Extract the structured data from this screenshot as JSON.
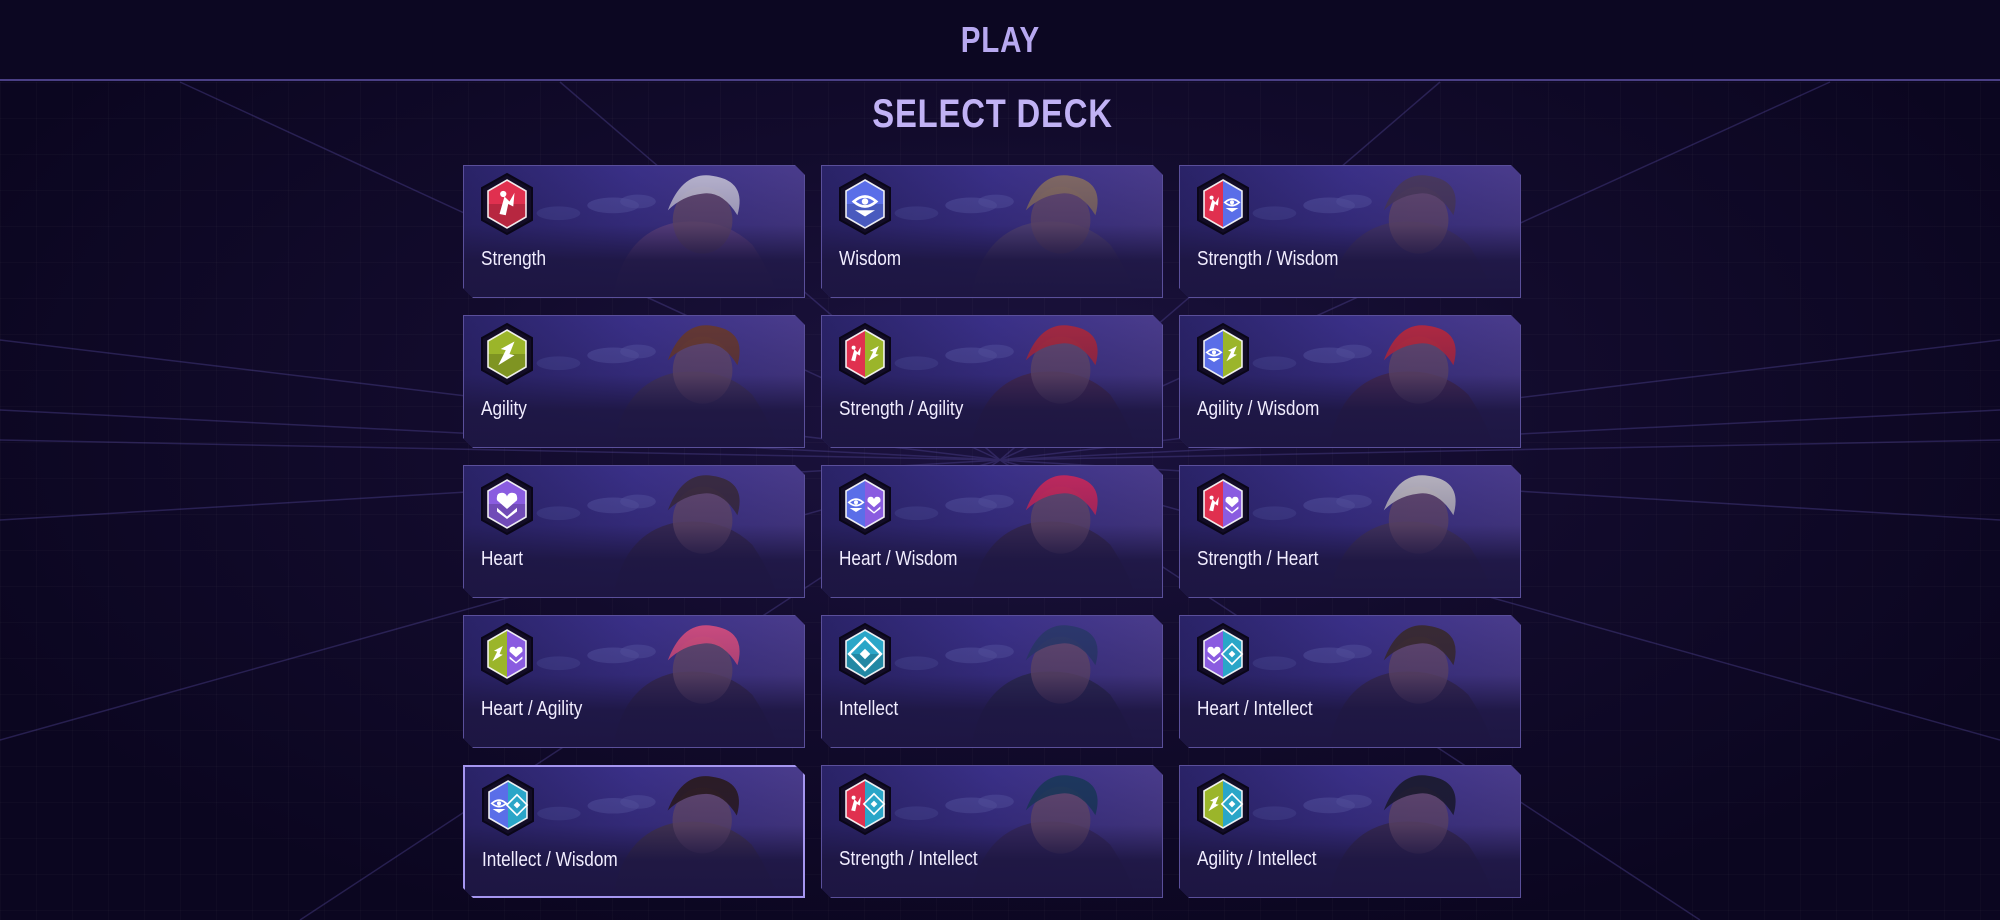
{
  "header": {
    "title": "PLAY"
  },
  "page": {
    "title": "SELECT DECK"
  },
  "colors": {
    "strength": "#e0304f",
    "wisdom": "#5a6ee8",
    "agility": "#9bb52a",
    "heart": "#8a5ce0",
    "intellect": "#2aa6c8",
    "accent": "#b7a8f0"
  },
  "decks": [
    {
      "label": "Strength",
      "attrs": [
        "strength"
      ],
      "icon": "strength-icon",
      "hue": "#6a4a8a",
      "hair": "#c8c4d8",
      "selected": false
    },
    {
      "label": "Wisdom",
      "attrs": [
        "wisdom"
      ],
      "icon": "wisdom-icon",
      "hue": "#5a4a7a",
      "hair": "#8a7060",
      "selected": false
    },
    {
      "label": "Strength / Wisdom",
      "attrs": [
        "strength",
        "wisdom"
      ],
      "icon": "strength-wisdom-icon",
      "hue": "#4a3a6a",
      "hair": "#4a3a5a",
      "selected": false
    },
    {
      "label": "Agility",
      "attrs": [
        "agility"
      ],
      "icon": "agility-icon",
      "hue": "#4a3a5a",
      "hair": "#6a3a2a",
      "selected": false
    },
    {
      "label": "Strength / Agility",
      "attrs": [
        "strength",
        "agility"
      ],
      "icon": "strength-agility-icon",
      "hue": "#4a2a4a",
      "hair": "#b0283a",
      "selected": false
    },
    {
      "label": "Agility / Wisdom",
      "attrs": [
        "wisdom",
        "agility"
      ],
      "icon": "agility-wisdom-icon",
      "hue": "#4a2a4a",
      "hair": "#c0283a",
      "selected": false
    },
    {
      "label": "Heart",
      "attrs": [
        "heart"
      ],
      "icon": "heart-icon",
      "hue": "#3a2a4a",
      "hair": "#3a2a3a",
      "selected": false
    },
    {
      "label": "Heart / Wisdom",
      "attrs": [
        "wisdom",
        "heart"
      ],
      "icon": "heart-wisdom-icon",
      "hue": "#3a2a4a",
      "hair": "#d0285a",
      "selected": false
    },
    {
      "label": "Strength / Heart",
      "attrs": [
        "strength",
        "heart"
      ],
      "icon": "strength-heart-icon",
      "hue": "#4a3a5a",
      "hair": "#c8c4c8",
      "selected": false
    },
    {
      "label": "Heart / Agility",
      "attrs": [
        "agility",
        "heart"
      ],
      "icon": "heart-agility-icon",
      "hue": "#3a2a4a",
      "hair": "#e05080",
      "selected": false
    },
    {
      "label": "Intellect",
      "attrs": [
        "intellect"
      ],
      "icon": "intellect-icon",
      "hue": "#2a2a4a",
      "hair": "#2a3a6a",
      "selected": false
    },
    {
      "label": "Heart / Intellect",
      "attrs": [
        "heart",
        "intellect"
      ],
      "icon": "heart-intellect-icon",
      "hue": "#3a2a4a",
      "hair": "#3a2a2a",
      "selected": false
    },
    {
      "label": "Intellect / Wisdom",
      "attrs": [
        "wisdom",
        "intellect"
      ],
      "icon": "intellect-wisdom-icon",
      "hue": "#4a3a4a",
      "hair": "#2a1a1a",
      "selected": true
    },
    {
      "label": "Strength / Intellect",
      "attrs": [
        "strength",
        "intellect"
      ],
      "icon": "strength-intellect-icon",
      "hue": "#3a2a5a",
      "hair": "#1a3a5a",
      "selected": false
    },
    {
      "label": "Agility / Intellect",
      "attrs": [
        "agility",
        "intellect"
      ],
      "icon": "agility-intellect-icon",
      "hue": "#3a2a4a",
      "hair": "#1a1a2a",
      "selected": false
    }
  ]
}
